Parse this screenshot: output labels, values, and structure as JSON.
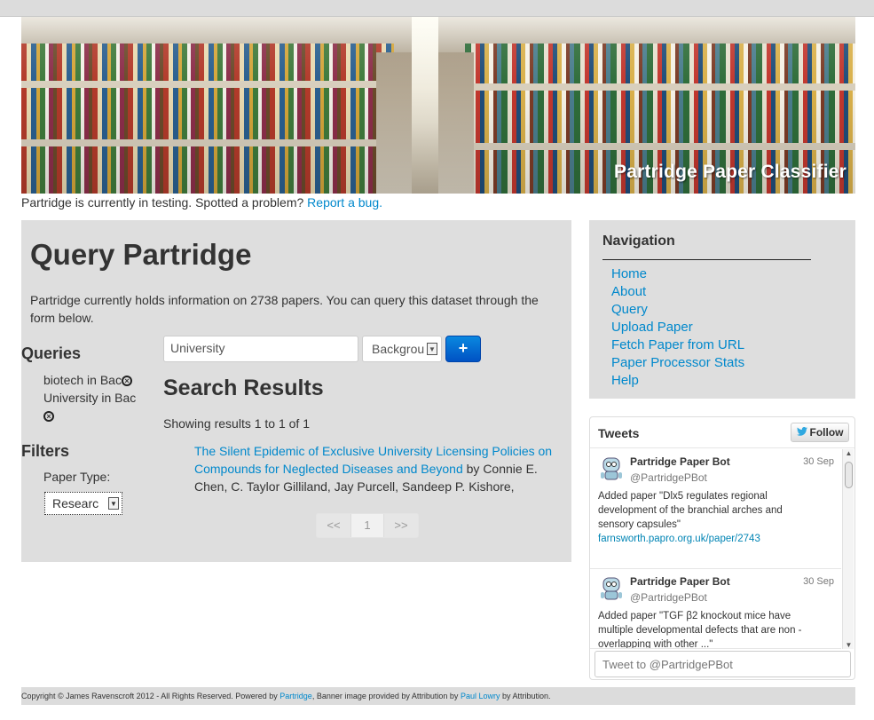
{
  "banner": {
    "title": "Partridge Paper Classifier"
  },
  "notice": {
    "text": "Partridge is currently in testing. Spotted a problem?",
    "link": "Report a bug."
  },
  "main": {
    "title": "Query Partridge",
    "intro": "Partridge currently holds information on 2738 papers. You can query this dataset through the form below.",
    "queries_heading": "Queries",
    "queries": [
      "biotech in Bac",
      "University in Bac"
    ],
    "filters_heading": "Filters",
    "paper_type_label": "Paper Type:",
    "paper_type_value": "Researc",
    "search_input_value": "University",
    "search_select_value": "Backgrou",
    "add_button": "+",
    "results_heading": "Search Results",
    "results_count": "Showing results 1 to 1 of 1",
    "result": {
      "title": "The Silent Epidemic of Exclusive University Licensing Policies on Compounds for Neglected Diseases and Beyond",
      "by": "by Connie E. Chen, C. Taylor Gilliland, Jay Purcell, Sandeep P. Kishore,"
    },
    "pagination": {
      "prev": "<<",
      "current": "1",
      "next": ">>"
    }
  },
  "nav": {
    "heading": "Navigation",
    "items": [
      "Home",
      "About",
      "Query",
      "Upload Paper",
      "Fetch Paper from URL",
      "Paper Processor Stats",
      "Help"
    ]
  },
  "tweets": {
    "title": "Tweets",
    "follow": "Follow",
    "items": [
      {
        "name": "Partridge Paper Bot",
        "handle": "@PartridgePBot",
        "date": "30 Sep",
        "text": "Added paper \"Dlx5 regulates regional development of the branchial arches and sensory capsules\"",
        "link": "farnsworth.papro.org.uk/paper/2743"
      },
      {
        "name": "Partridge Paper Bot",
        "handle": "@PartridgePBot",
        "date": "30 Sep",
        "text": "Added paper \"TGF β2 knockout mice have multiple developmental defects that are non - overlapping with other ...\"",
        "link": ""
      }
    ],
    "compose_placeholder": "Tweet to @PartridgePBot"
  },
  "footer": {
    "text_1": "Copyright © James Ravenscroft 2012 - All Rights Reserved. Powered by",
    "link_1": "Partridge",
    "text_2": ", Banner image provided by Attribution by",
    "link_2": "Paul Lowry",
    "text_3": "by Attribution."
  },
  "colors": {
    "link": "#0088cc",
    "panel": "#dedede",
    "button": "#0066cc"
  }
}
